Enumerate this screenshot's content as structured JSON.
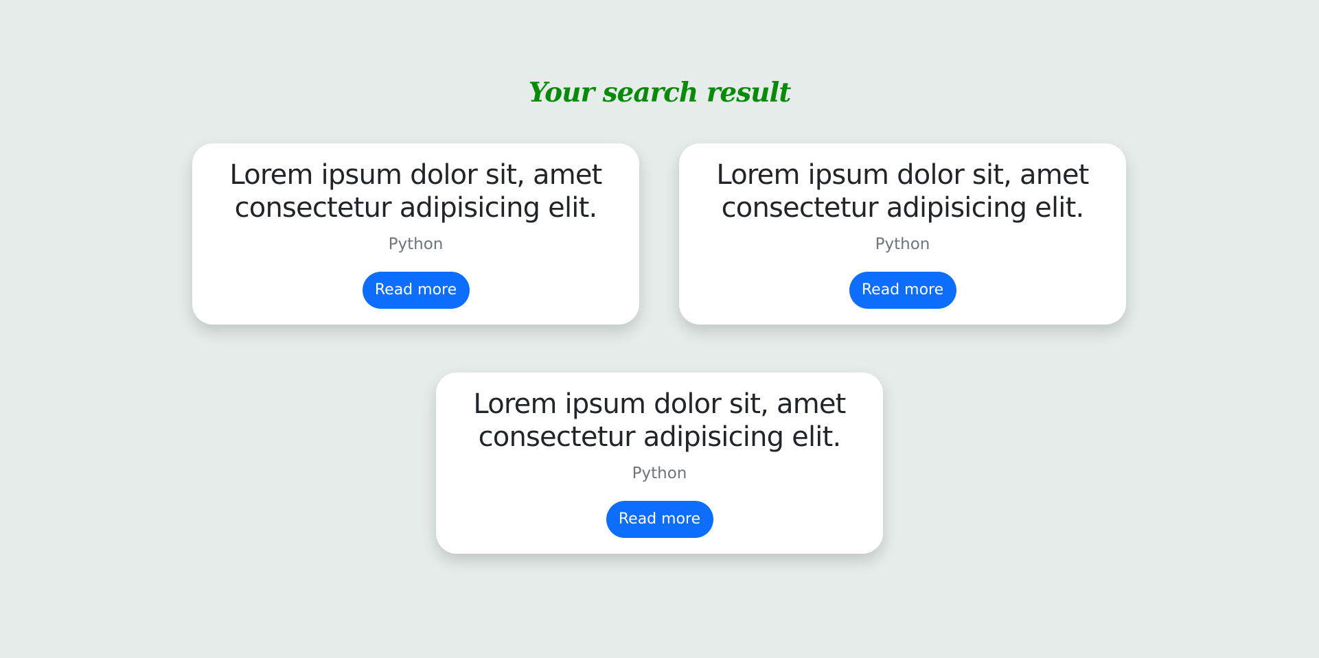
{
  "page": {
    "heading": "Your search result",
    "colors": {
      "background": "#e5ecea",
      "heading": "#0a8a0a",
      "card": "#ffffff",
      "button": "#0d6efd",
      "button_text": "#ffffff",
      "title_text": "#212529",
      "tag_text": "#6c757d"
    }
  },
  "results": [
    {
      "title": "Lorem ipsum dolor sit, amet consectetur adipisicing elit.",
      "tag": "Python",
      "button_label": "Read more"
    },
    {
      "title": "Lorem ipsum dolor sit, amet consectetur adipisicing elit.",
      "tag": "Python",
      "button_label": "Read more"
    },
    {
      "title": "Lorem ipsum dolor sit, amet consectetur adipisicing elit.",
      "tag": "Python",
      "button_label": "Read more"
    }
  ]
}
